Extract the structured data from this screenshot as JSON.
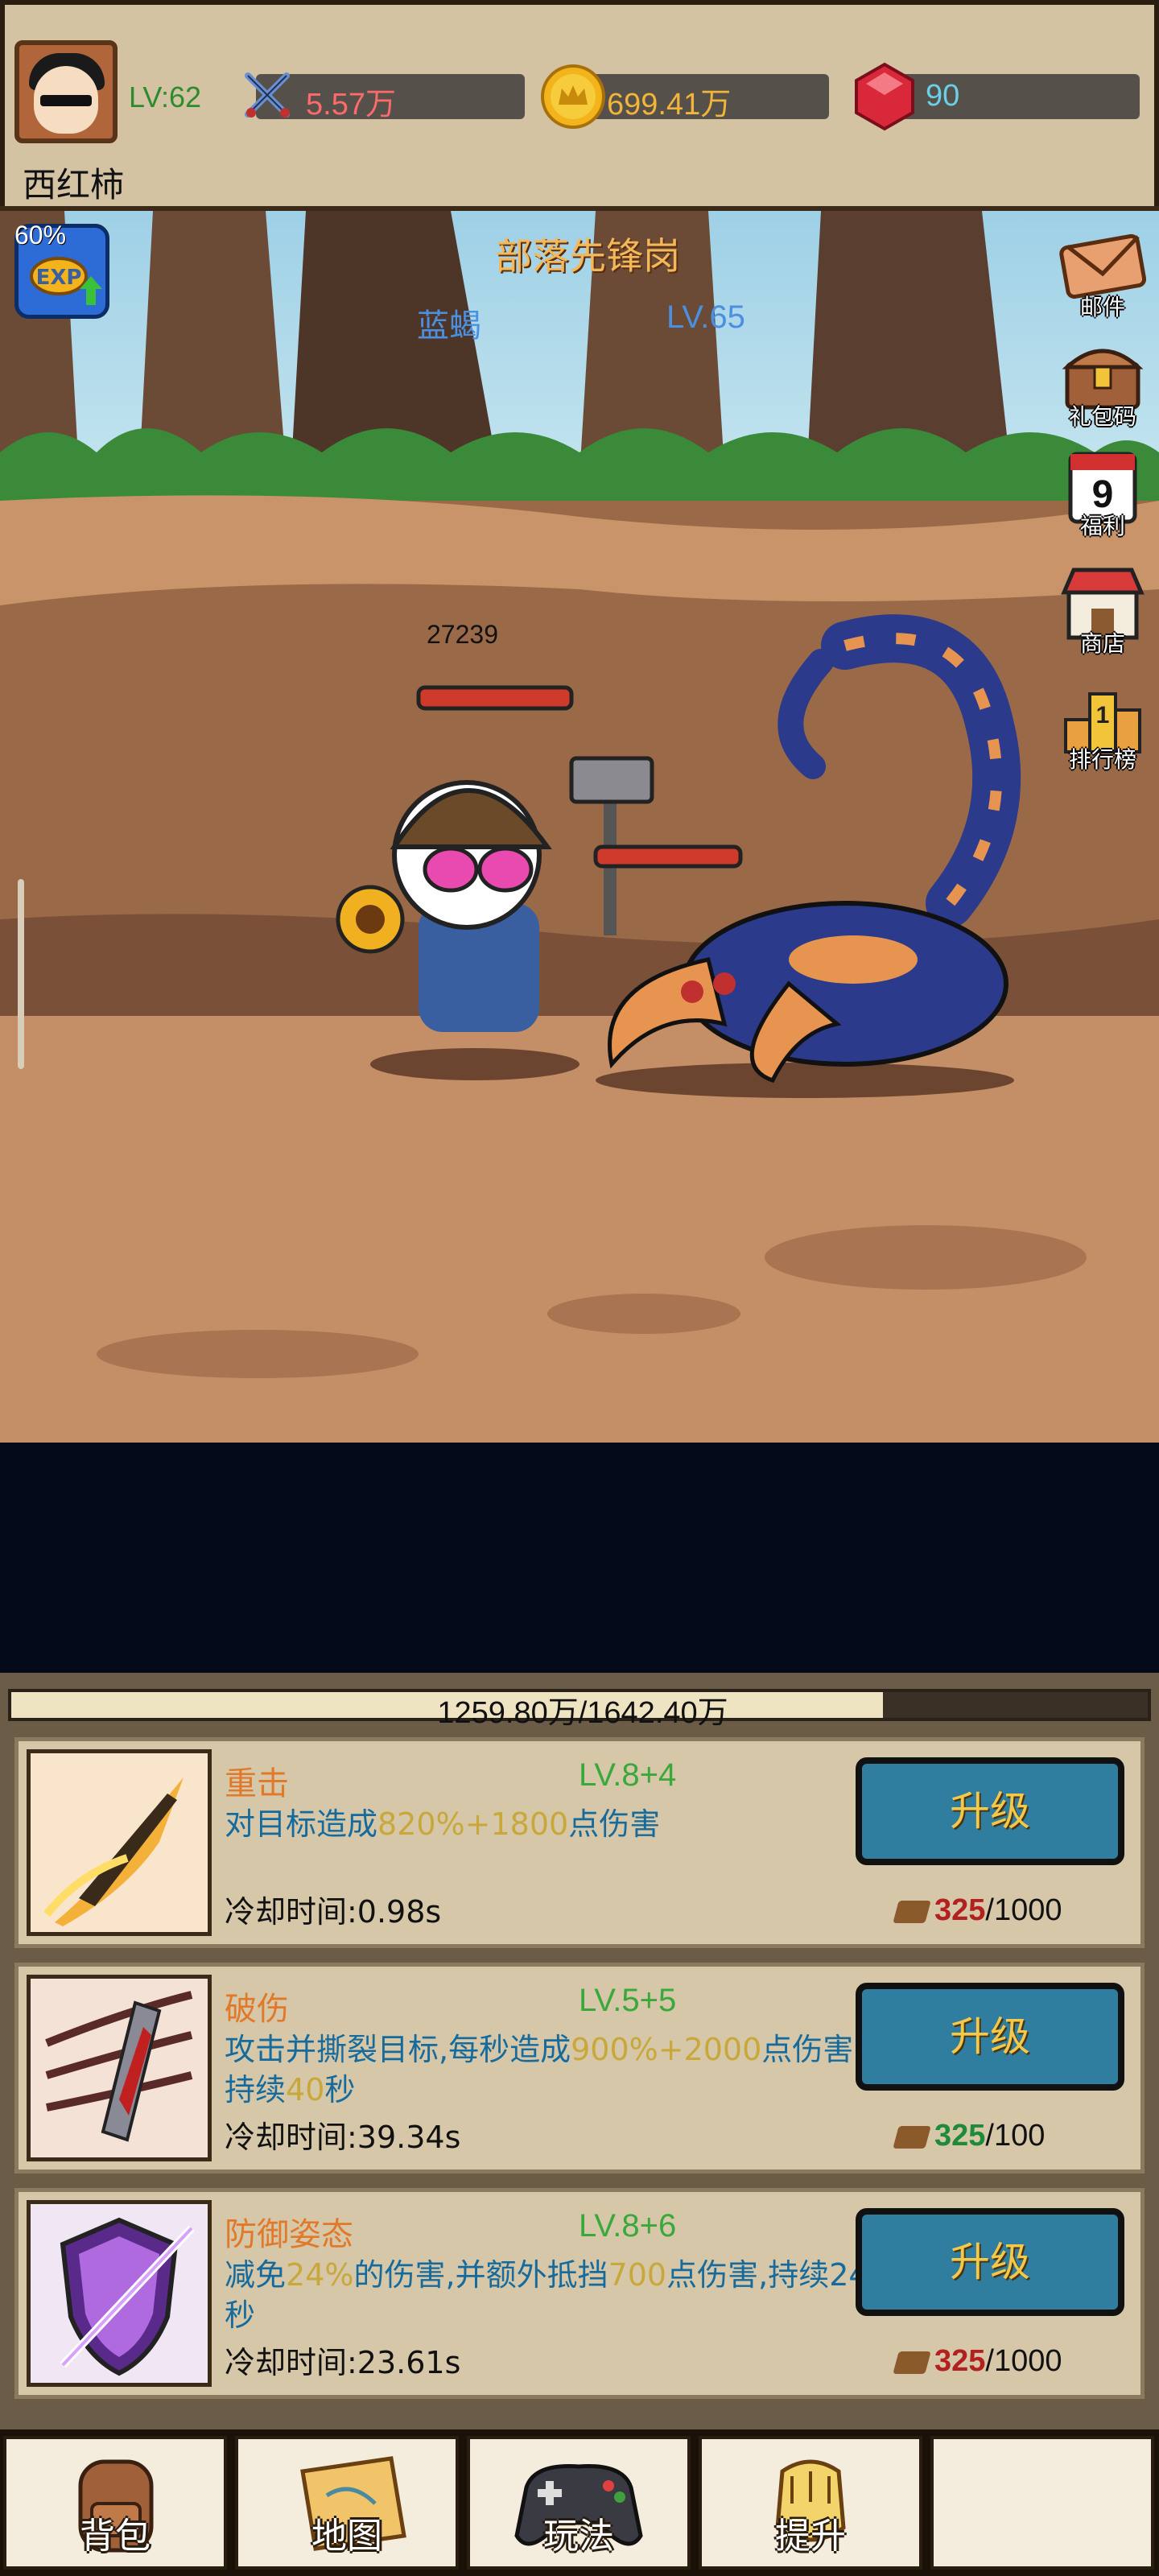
{
  "player": {
    "name": "西红柿",
    "level": "LV:62"
  },
  "resources": {
    "power": "5.57万",
    "gold": "699.41万",
    "gems": "90"
  },
  "stage": {
    "title": "部落先锋岗",
    "exp_percent": "60%"
  },
  "enemy": {
    "name": "蓝蝎",
    "level": "LV.65",
    "hp": "27239"
  },
  "side_menu": [
    {
      "label": "邮件",
      "icon": "mail-icon"
    },
    {
      "label": "礼包码",
      "icon": "gift-chest-icon"
    },
    {
      "label": "福利",
      "icon": "calendar-icon",
      "badge": "9"
    },
    {
      "label": "商店",
      "icon": "shop-icon"
    },
    {
      "label": "排行榜",
      "icon": "ranking-icon"
    }
  ],
  "boss_progress": {
    "text": "1259.80万/1642.40万",
    "fraction": 0.767
  },
  "skills": [
    {
      "name": "重击",
      "level": "LV.8+4",
      "desc_a": "对目标造成",
      "desc_hl": "820%+1800",
      "desc_b": "点伤害",
      "desc_hl2": "",
      "desc_c": "",
      "cooldown": "冷却时间:0.98s",
      "button": "升级",
      "cost_have": "325",
      "cost_need": "/1000",
      "enough": false,
      "icon": "blade-skill-icon"
    },
    {
      "name": "破伤",
      "level": "LV.5+5",
      "desc_a": "攻击并撕裂目标,每秒造成",
      "desc_hl": "900%+2000",
      "desc_b": "点伤害,持续",
      "desc_hl2": "40",
      "desc_c": "秒",
      "cooldown": "冷却时间:39.34s",
      "button": "升级",
      "cost_have": "325",
      "cost_need": "/100",
      "enough": true,
      "icon": "claw-skill-icon"
    },
    {
      "name": "防御姿态",
      "level": "LV.8+6",
      "desc_a": "减免",
      "desc_hl": "24%",
      "desc_b": "的伤害,并额外抵挡",
      "desc_hl2": "700",
      "desc_c": "点伤害,持续24秒",
      "cooldown": "冷却时间:23.61s",
      "button": "升级",
      "cost_have": "325",
      "cost_need": "/1000",
      "enough": false,
      "icon": "shield-skill-icon"
    }
  ],
  "nav": [
    {
      "label": "背包",
      "icon": "backpack-icon"
    },
    {
      "label": "地图",
      "icon": "map-icon"
    },
    {
      "label": "玩法",
      "icon": "gamepad-icon"
    },
    {
      "label": "提升",
      "icon": "fist-icon"
    },
    {
      "label": "",
      "icon": ""
    }
  ],
  "colors": {
    "hud_bg": "#d4c3a3",
    "accent_gold": "#f3b85a",
    "button_blue": "#2f7ea0",
    "level_green": "#3aa83a",
    "cost_red": "#b32020"
  }
}
